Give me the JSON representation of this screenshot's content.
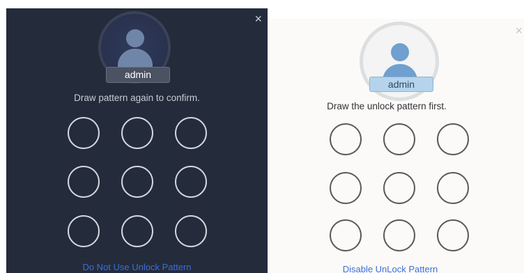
{
  "dark_dialog": {
    "username": "admin",
    "instruction": "Draw pattern again to confirm.",
    "footer_link": "Do Not Use Unlock Pattern",
    "close_icon": "×"
  },
  "light_dialog": {
    "username": "admin",
    "instruction": "Draw the unlock pattern first.",
    "footer_link": "Disable UnLock Pattern",
    "close_icon": "×"
  },
  "colors": {
    "dark_background": "#242b3b",
    "light_background": "#fcfaf8",
    "link": "#3a6fd8"
  }
}
